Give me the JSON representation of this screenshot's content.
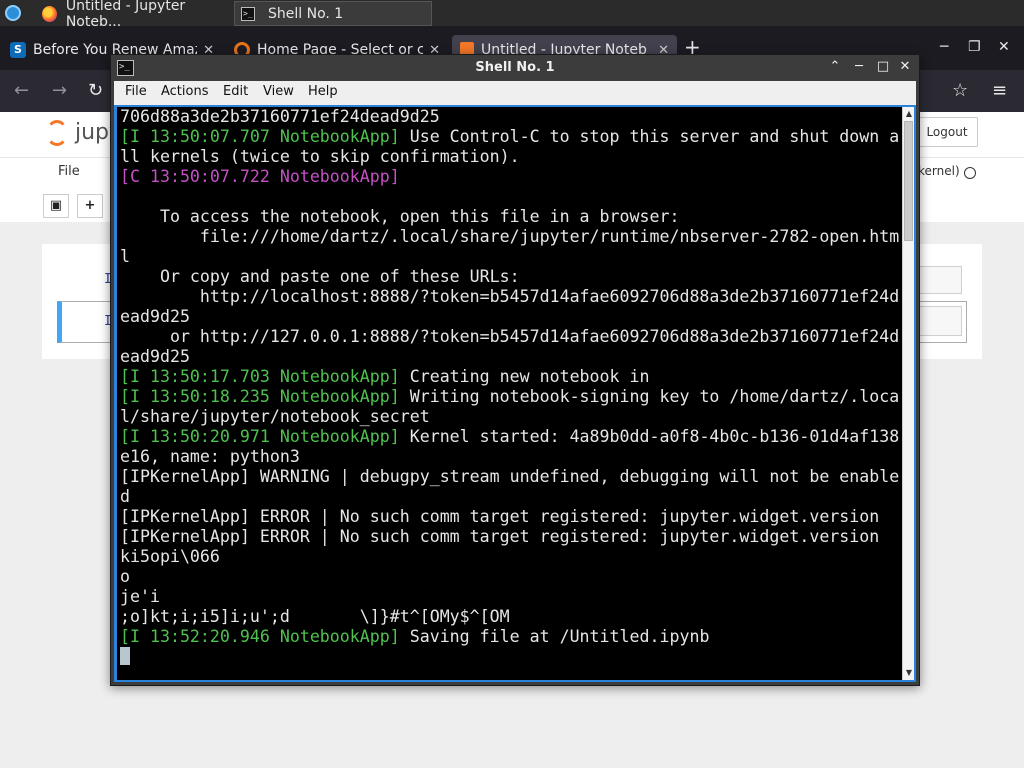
{
  "taskbar": {
    "tasks": [
      {
        "label": "Untitled - Jupyter Noteb..."
      },
      {
        "label": "Shell No. 1"
      }
    ]
  },
  "browser": {
    "tabs": [
      {
        "title": "Before You Renew Amaz"
      },
      {
        "title": "Home Page - Select or cr"
      },
      {
        "title": "Untitled - Jupyter Noteb"
      }
    ],
    "new_tab": "+",
    "close_glyph": "✕"
  },
  "jupyter": {
    "logo_text": "jupy",
    "logout_label": "Logout",
    "menu_file": "File",
    "kernel_label": "kernel)",
    "cell_prompt": "I"
  },
  "terminal": {
    "title": "Shell No. 1",
    "title_icon": ">_",
    "menu": [
      "File",
      "Actions",
      "Edit",
      "View",
      "Help"
    ],
    "lines": [
      {
        "p": "",
        "t": "706d88a3de2b37160771ef24dead9d25"
      },
      {
        "p": "[I 13:50:07.707 NotebookApp]",
        "pc": "g",
        "t": " Use Control-C to stop this server and shut down a"
      },
      {
        "p": "",
        "t": "ll kernels (twice to skip confirmation)."
      },
      {
        "p": "[C 13:50:07.722 NotebookApp]",
        "pc": "m",
        "t": ""
      },
      {
        "p": "",
        "t": ""
      },
      {
        "p": "",
        "t": "    To access the notebook, open this file in a browser:"
      },
      {
        "p": "",
        "t": "        file:///home/dartz/.local/share/jupyter/runtime/nbserver-2782-open.htm"
      },
      {
        "p": "",
        "t": "l"
      },
      {
        "p": "",
        "t": "    Or copy and paste one of these URLs:"
      },
      {
        "p": "",
        "t": "        http://localhost:8888/?token=b5457d14afae6092706d88a3de2b37160771ef24d"
      },
      {
        "p": "",
        "t": "ead9d25"
      },
      {
        "p": "",
        "t": "     or http://127.0.0.1:8888/?token=b5457d14afae6092706d88a3de2b37160771ef24d"
      },
      {
        "p": "",
        "t": "ead9d25"
      },
      {
        "p": "[I 13:50:17.703 NotebookApp]",
        "pc": "g",
        "t": " Creating new notebook in"
      },
      {
        "p": "[I 13:50:18.235 NotebookApp]",
        "pc": "g",
        "t": " Writing notebook-signing key to /home/dartz/.loca"
      },
      {
        "p": "",
        "t": "l/share/jupyter/notebook_secret"
      },
      {
        "p": "[I 13:50:20.971 NotebookApp]",
        "pc": "g",
        "t": " Kernel started: 4a89b0dd-a0f8-4b0c-b136-01d4af138"
      },
      {
        "p": "",
        "t": "e16, name: python3"
      },
      {
        "p": "",
        "t": "[IPKernelApp] WARNING | debugpy_stream undefined, debugging will not be enable"
      },
      {
        "p": "",
        "t": "d"
      },
      {
        "p": "",
        "t": "[IPKernelApp] ERROR | No such comm target registered: jupyter.widget.version"
      },
      {
        "p": "",
        "t": "[IPKernelApp] ERROR | No such comm target registered: jupyter.widget.version"
      },
      {
        "p": "",
        "t": "ki5opi\\066"
      },
      {
        "p": "",
        "t": "o"
      },
      {
        "p": "",
        "t": "je'i"
      },
      {
        "p": "",
        "t": ";o]kt;i;i5]i;u';d       \\]}#t^[OMy$^[OM"
      },
      {
        "p": "[I 13:52:20.946 NotebookApp]",
        "pc": "g",
        "t": " Saving file at /Untitled.ipynb"
      }
    ]
  },
  "colors": {
    "terminal_green": "#4ec24e",
    "terminal_magenta": "#c54fc5",
    "selection_blue": "#2a82da",
    "jupyter_orange": "#f37726"
  }
}
